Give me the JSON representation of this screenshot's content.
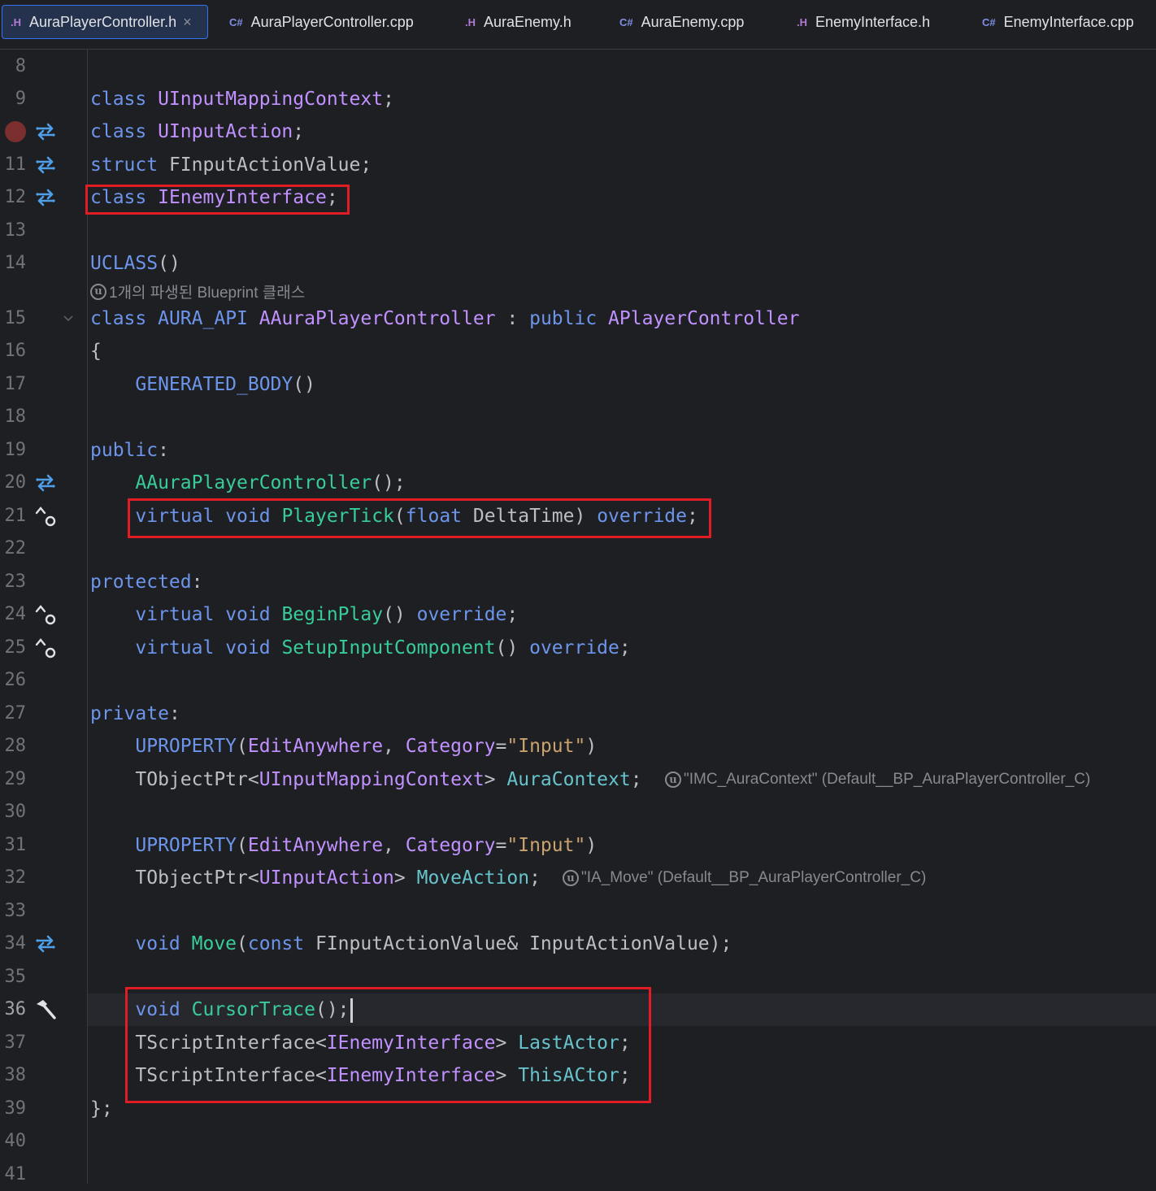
{
  "tabs": [
    {
      "label": "AuraPlayerController.h",
      "type": "h",
      "active": true
    },
    {
      "label": "AuraPlayerController.cpp",
      "type": "cpp"
    },
    {
      "label": "AuraEnemy.h",
      "type": "h"
    },
    {
      "label": "AuraEnemy.cpp",
      "type": "cpp"
    },
    {
      "label": "EnemyInterface.h",
      "type": "h"
    },
    {
      "label": "EnemyInterface.cpp",
      "type": "cpp"
    }
  ],
  "tab_icons": {
    "h": ".H",
    "cpp": "C#"
  },
  "tab_close": "×",
  "line_numbers": [
    "8",
    "9",
    "",
    "11",
    "12",
    "13",
    "14",
    "15",
    "16",
    "17",
    "18",
    "19",
    "20",
    "21",
    "22",
    "23",
    "24",
    "25",
    "26",
    "27",
    "28",
    "29",
    "30",
    "31",
    "32",
    "33",
    "34",
    "35",
    "36",
    "37",
    "38",
    "39",
    "40",
    "41"
  ],
  "current_line": "36",
  "code": {
    "l9": [
      [
        "kw",
        "class"
      ],
      [
        "pl",
        " "
      ],
      [
        "ty",
        "UInputMappingContext"
      ],
      [
        "pl",
        ";"
      ]
    ],
    "l10": [
      [
        "kw",
        "class"
      ],
      [
        "pl",
        " "
      ],
      [
        "ty",
        "UInputAction"
      ],
      [
        "pl",
        ";"
      ]
    ],
    "l11": [
      [
        "kw",
        "struct"
      ],
      [
        "pl",
        " "
      ],
      [
        "pl",
        "FInputActionValue"
      ],
      [
        "pl",
        ";"
      ]
    ],
    "l12": [
      [
        "kw",
        "class"
      ],
      [
        "pl",
        " "
      ],
      [
        "ty",
        "IEnemyInterface"
      ],
      [
        "pl",
        ";"
      ]
    ],
    "l14": [
      [
        "mac",
        "UCLASS"
      ],
      [
        "pl",
        "()"
      ]
    ],
    "l15": [
      [
        "kw",
        "class"
      ],
      [
        "pl",
        " "
      ],
      [
        "mac",
        "AURA_API"
      ],
      [
        "pl",
        " "
      ],
      [
        "ty",
        "AAuraPlayerController"
      ],
      [
        "pl",
        " : "
      ],
      [
        "kw",
        "public"
      ],
      [
        "pl",
        " "
      ],
      [
        "ty",
        "APlayerController"
      ]
    ],
    "l16": [
      [
        "pl",
        "{"
      ]
    ],
    "l17": [
      [
        "pl",
        "    "
      ],
      [
        "mac",
        "GENERATED_BODY"
      ],
      [
        "pl",
        "()"
      ]
    ],
    "l19": [
      [
        "kw",
        "public"
      ],
      [
        "pl",
        ":"
      ]
    ],
    "l20": [
      [
        "pl",
        "    "
      ],
      [
        "fn",
        "AAuraPlayerController"
      ],
      [
        "pl",
        "();"
      ]
    ],
    "l21": [
      [
        "pl",
        "    "
      ],
      [
        "kw",
        "virtual"
      ],
      [
        "pl",
        " "
      ],
      [
        "kw",
        "void"
      ],
      [
        "pl",
        " "
      ],
      [
        "fn",
        "PlayerTick"
      ],
      [
        "pl",
        "("
      ],
      [
        "kw",
        "float"
      ],
      [
        "pl",
        " DeltaTime) "
      ],
      [
        "kw",
        "override"
      ],
      [
        "pl",
        ";"
      ]
    ],
    "l23": [
      [
        "kw",
        "protected"
      ],
      [
        "pl",
        ":"
      ]
    ],
    "l24": [
      [
        "pl",
        "    "
      ],
      [
        "kw",
        "virtual"
      ],
      [
        "pl",
        " "
      ],
      [
        "kw",
        "void"
      ],
      [
        "pl",
        " "
      ],
      [
        "fn",
        "BeginPlay"
      ],
      [
        "pl",
        "() "
      ],
      [
        "kw",
        "override"
      ],
      [
        "pl",
        ";"
      ]
    ],
    "l25": [
      [
        "pl",
        "    "
      ],
      [
        "kw",
        "virtual"
      ],
      [
        "pl",
        " "
      ],
      [
        "kw",
        "void"
      ],
      [
        "pl",
        " "
      ],
      [
        "fn",
        "SetupInputComponent"
      ],
      [
        "pl",
        "() "
      ],
      [
        "kw",
        "override"
      ],
      [
        "pl",
        ";"
      ]
    ],
    "l27": [
      [
        "kw",
        "private"
      ],
      [
        "pl",
        ":"
      ]
    ],
    "l28": [
      [
        "pl",
        "    "
      ],
      [
        "mac",
        "UPROPERTY"
      ],
      [
        "pl",
        "("
      ],
      [
        "ty",
        "EditAnywhere"
      ],
      [
        "pl",
        ", "
      ],
      [
        "ty",
        "Category"
      ],
      [
        "pl",
        "="
      ],
      [
        "str",
        "\"Input\""
      ],
      [
        "pl",
        ")"
      ]
    ],
    "l29": [
      [
        "pl",
        "    "
      ],
      [
        "pl",
        "TObjectPtr<"
      ],
      [
        "ty",
        "UInputMappingContext"
      ],
      [
        "pl",
        "> "
      ],
      [
        "fld",
        "AuraContext"
      ],
      [
        "pl",
        ";"
      ]
    ],
    "l31": [
      [
        "pl",
        "    "
      ],
      [
        "mac",
        "UPROPERTY"
      ],
      [
        "pl",
        "("
      ],
      [
        "ty",
        "EditAnywhere"
      ],
      [
        "pl",
        ", "
      ],
      [
        "ty",
        "Category"
      ],
      [
        "pl",
        "="
      ],
      [
        "str",
        "\"Input\""
      ],
      [
        "pl",
        ")"
      ]
    ],
    "l32": [
      [
        "pl",
        "    "
      ],
      [
        "pl",
        "TObjectPtr<"
      ],
      [
        "ty",
        "UInputAction"
      ],
      [
        "pl",
        "> "
      ],
      [
        "fld",
        "MoveAction"
      ],
      [
        "pl",
        ";"
      ]
    ],
    "l34": [
      [
        "pl",
        "    "
      ],
      [
        "kw",
        "void"
      ],
      [
        "pl",
        " "
      ],
      [
        "fn",
        "Move"
      ],
      [
        "pl",
        "("
      ],
      [
        "kw",
        "const"
      ],
      [
        "pl",
        " FInputActionValue& InputActionValue);"
      ]
    ],
    "l36": [
      [
        "pl",
        "    "
      ],
      [
        "kw",
        "void"
      ],
      [
        "pl",
        " "
      ],
      [
        "fn",
        "CursorTrace"
      ],
      [
        "pl",
        "();"
      ]
    ],
    "l37": [
      [
        "pl",
        "    "
      ],
      [
        "pl",
        "TScriptInterface<"
      ],
      [
        "ty",
        "IEnemyInterface"
      ],
      [
        "pl",
        "> "
      ],
      [
        "fld",
        "LastActor"
      ],
      [
        "pl",
        ";"
      ]
    ],
    "l38": [
      [
        "pl",
        "    "
      ],
      [
        "pl",
        "TScriptInterface<"
      ],
      [
        "ty",
        "IEnemyInterface"
      ],
      [
        "pl",
        "> "
      ],
      [
        "fld",
        "ThisACtor"
      ],
      [
        "pl",
        ";"
      ]
    ],
    "l39": [
      [
        "pl",
        "};"
      ]
    ]
  },
  "hints": {
    "uclass": "1개의 파생된 Blueprint 클래스",
    "aura_context": "\"IMC_AuraContext\" (Default__BP_AuraPlayerController_C)",
    "move_action": "\"IA_Move\" (Default__BP_AuraPlayerController_C)",
    "ubadge": "u"
  },
  "colors": {
    "background": "#1e1f22",
    "keyword": "#6c95eb",
    "type": "#c191ff",
    "function": "#39cc9b",
    "field": "#66c3cc",
    "string": "#c9a26d",
    "highlight_box": "#e01c24",
    "breakpoint": "#7a2e2e"
  },
  "gutter_icons": {
    "breakpoint_line": "breakpoint-icon",
    "navigate": "navigate-arrows-icon",
    "override": "override-icon",
    "build": "hammer-icon"
  }
}
